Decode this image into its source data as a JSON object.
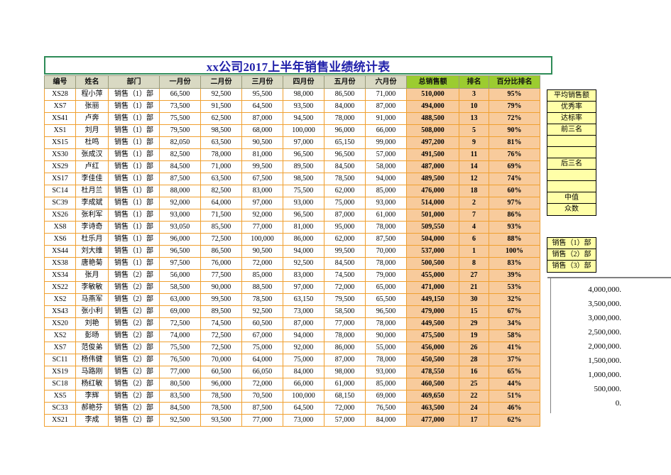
{
  "title": "xx公司2017上半年销售业绩统计表",
  "table": {
    "headers": [
      "编号",
      "姓名",
      "部门",
      "一月份",
      "二月份",
      "三月份",
      "四月份",
      "五月份",
      "六月份",
      "总销售额",
      "排名",
      "百分比排名"
    ],
    "rows": [
      [
        "XS28",
        "程小萍",
        "销售（1）部",
        "66,500",
        "92,500",
        "95,500",
        "98,000",
        "86,500",
        "71,000",
        "510,000",
        "3",
        "95%"
      ],
      [
        "XS7",
        "张丽",
        "销售（1）部",
        "73,500",
        "91,500",
        "64,500",
        "93,500",
        "84,000",
        "87,000",
        "494,000",
        "10",
        "79%"
      ],
      [
        "XS41",
        "卢奔",
        "销售（1）部",
        "75,500",
        "62,500",
        "87,000",
        "94,500",
        "78,000",
        "91,000",
        "488,500",
        "13",
        "72%"
      ],
      [
        "XS1",
        "刘月",
        "销售（1）部",
        "79,500",
        "98,500",
        "68,000",
        "100,000",
        "96,000",
        "66,000",
        "508,000",
        "5",
        "90%"
      ],
      [
        "XS15",
        "杜鸣",
        "销售（1）部",
        "82,050",
        "63,500",
        "90,500",
        "97,000",
        "65,150",
        "99,000",
        "497,200",
        "9",
        "81%"
      ],
      [
        "XS30",
        "张成汉",
        "销售（1）部",
        "82,500",
        "78,000",
        "81,000",
        "96,500",
        "96,500",
        "57,000",
        "491,500",
        "11",
        "76%"
      ],
      [
        "XS29",
        "卢红",
        "销售（1）部",
        "84,500",
        "71,000",
        "99,500",
        "89,500",
        "84,500",
        "58,000",
        "487,000",
        "14",
        "69%"
      ],
      [
        "XS17",
        "李佳佳",
        "销售（1）部",
        "87,500",
        "63,500",
        "67,500",
        "98,500",
        "78,500",
        "94,000",
        "489,500",
        "12",
        "74%"
      ],
      [
        "SC14",
        "杜月兰",
        "销售（1）部",
        "88,000",
        "82,500",
        "83,000",
        "75,500",
        "62,000",
        "85,000",
        "476,000",
        "18",
        "60%"
      ],
      [
        "SC39",
        "李成斌",
        "销售（1）部",
        "92,000",
        "64,000",
        "97,000",
        "93,000",
        "75,000",
        "93,000",
        "514,000",
        "2",
        "97%"
      ],
      [
        "XS26",
        "张利军",
        "销售（1）部",
        "93,000",
        "71,500",
        "92,000",
        "96,500",
        "87,000",
        "61,000",
        "501,000",
        "7",
        "86%"
      ],
      [
        "XS8",
        "李诗奇",
        "销售（1）部",
        "93,050",
        "85,500",
        "77,000",
        "81,000",
        "95,000",
        "78,000",
        "509,550",
        "4",
        "93%"
      ],
      [
        "XS6",
        "杜乐月",
        "销售（1）部",
        "96,000",
        "72,500",
        "100,000",
        "86,000",
        "62,000",
        "87,500",
        "504,000",
        "6",
        "88%"
      ],
      [
        "XS44",
        "刘大维",
        "销售（1）部",
        "96,500",
        "86,500",
        "90,500",
        "94,000",
        "99,500",
        "70,000",
        "537,000",
        "1",
        "100%"
      ],
      [
        "XS38",
        "唐艳菊",
        "销售（1）部",
        "97,500",
        "76,000",
        "72,000",
        "92,500",
        "84,500",
        "78,000",
        "500,500",
        "8",
        "83%"
      ],
      [
        "XS34",
        "张月",
        "销售（2）部",
        "56,000",
        "77,500",
        "85,000",
        "83,000",
        "74,500",
        "79,000",
        "455,000",
        "27",
        "39%"
      ],
      [
        "XS22",
        "李敏敏",
        "销售（2）部",
        "58,500",
        "90,000",
        "88,500",
        "97,000",
        "72,000",
        "65,000",
        "471,000",
        "21",
        "53%"
      ],
      [
        "XS2",
        "马燕军",
        "销售（2）部",
        "63,000",
        "99,500",
        "78,500",
        "63,150",
        "79,500",
        "65,500",
        "449,150",
        "30",
        "32%"
      ],
      [
        "XS43",
        "张小利",
        "销售（2）部",
        "69,000",
        "89,500",
        "92,500",
        "73,000",
        "58,500",
        "96,500",
        "479,000",
        "15",
        "67%"
      ],
      [
        "XS20",
        "刘艳",
        "销售（2）部",
        "72,500",
        "74,500",
        "60,500",
        "87,000",
        "77,000",
        "78,000",
        "449,500",
        "29",
        "34%"
      ],
      [
        "XS2",
        "彭旸",
        "销售（2）部",
        "74,000",
        "72,500",
        "67,000",
        "94,000",
        "78,000",
        "90,000",
        "475,500",
        "19",
        "58%"
      ],
      [
        "XS7",
        "范俊弟",
        "销售（2）部",
        "75,500",
        "72,500",
        "75,000",
        "92,000",
        "86,000",
        "55,000",
        "456,000",
        "26",
        "41%"
      ],
      [
        "SC11",
        "杨伟健",
        "销售（2）部",
        "76,500",
        "70,000",
        "64,000",
        "75,000",
        "87,000",
        "78,000",
        "450,500",
        "28",
        "37%"
      ],
      [
        "XS19",
        "马路刚",
        "销售（2）部",
        "77,000",
        "60,500",
        "66,050",
        "84,000",
        "98,000",
        "93,000",
        "478,550",
        "16",
        "65%"
      ],
      [
        "SC18",
        "杨红敏",
        "销售（2）部",
        "80,500",
        "96,000",
        "72,000",
        "66,000",
        "61,000",
        "85,000",
        "460,500",
        "25",
        "44%"
      ],
      [
        "XS5",
        "李辉",
        "销售（2）部",
        "83,500",
        "78,500",
        "70,500",
        "100,000",
        "68,150",
        "69,000",
        "469,650",
        "22",
        "51%"
      ],
      [
        "SC33",
        "郝艳芬",
        "销售（2）部",
        "84,500",
        "78,500",
        "87,500",
        "64,500",
        "72,000",
        "76,500",
        "463,500",
        "24",
        "46%"
      ],
      [
        "XS21",
        "李成",
        "销售（2）部",
        "92,500",
        "93,500",
        "77,000",
        "73,000",
        "57,000",
        "84,000",
        "477,000",
        "17",
        "62%"
      ]
    ]
  },
  "stats_panel": {
    "labels": [
      "平均销售额",
      "优秀率",
      "达标率",
      "前三名",
      "",
      "",
      "后三名",
      "",
      "",
      "中值",
      "众数"
    ]
  },
  "dept_panel": {
    "labels": [
      "销售（1）部",
      "销售（2）部",
      "销售（3）部"
    ]
  },
  "chart_data": {
    "type": "bar",
    "title": "",
    "xlabel": "",
    "ylabel": "",
    "categories": [],
    "values": [],
    "yticks": [
      "4,000,000.",
      "3,500,000.",
      "3,000,000.",
      "2,500,000.",
      "2,000,000.",
      "1,500,000.",
      "1,000,000.",
      "500,000.",
      "0."
    ],
    "ylim": [
      0,
      4000000
    ],
    "grid": false,
    "legend_position": "none",
    "note": "chart clipped at right edge of screenshot; only y-axis tick labels visible"
  },
  "colors": {
    "title_text": "#2222AA",
    "title_border": "#2E8B57",
    "header_plain_bg": "#D9D9C3",
    "header_green_bg": "#9CCC30",
    "highlight_cell_bg": "#F8CB9C",
    "cell_border": "#F0A030",
    "panel_yellow_bg": "#FFFFA8"
  }
}
